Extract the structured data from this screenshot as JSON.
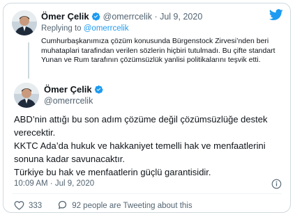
{
  "quoted": {
    "name": "Ömer Çelik",
    "handle": "@omerrcelik",
    "date": "Jul 9, 2020",
    "separator": "·",
    "replying_prefix": "Replying to",
    "replying_to": "@omerrcelik",
    "text": "Cumhurbaşkanımıza çözüm konusunda Bürgenstock Zirvesi’nden beri muhataplari tarafindan verilen sözlerin hiçbiri tutulmadı. Bu çifte standart Yunan ve Rum tarafının çözümsüzlük yanlisi politikalarını teşvik etti."
  },
  "main": {
    "name": "Ömer Çelik",
    "handle": "@omerrcelik",
    "lines": [
      "ABD’nin attığı bu son adım çözüme değil çözümsüzlüğe destek verecektir.",
      "KKTC Ada’da hukuk ve hakkaniyet temelli hak ve menfaatlerini sonuna kadar savunacaktır.",
      "Türkiye bu hak ve menfaatlerin güçlü garantisidir."
    ],
    "time": "10:09 AM",
    "separator": "·",
    "date": "Jul 9, 2020"
  },
  "actions": {
    "like_count": "333",
    "discussion_text": "92 people are Tweeting about this"
  },
  "icons": {
    "brand": "twitter-bird-icon",
    "verified": "verified-badge-icon",
    "info": "info-icon",
    "like": "heart-icon",
    "discussion": "speech-bubble-icon"
  },
  "colors": {
    "accent": "#1d9bf0",
    "text": "#0f1419",
    "muted": "#536471",
    "border": "#cfd9de"
  }
}
